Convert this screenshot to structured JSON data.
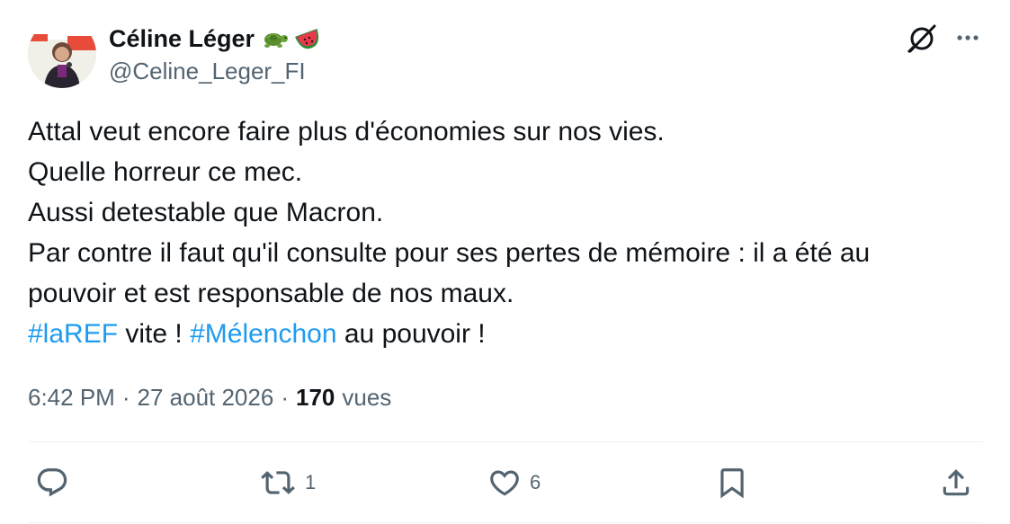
{
  "author": {
    "display_name": "Céline Léger",
    "handle": "@Celine_Leger_FI",
    "emojis": [
      "turtle-emoji",
      "watermelon-emoji"
    ]
  },
  "tweet": {
    "lines": [
      "Attal veut encore faire plus d'économies sur nos vies.",
      "Quelle horreur ce mec.",
      "Aussi detestable que Macron.",
      "Par contre il faut qu'il consulte pour ses pertes de mémoire : il a été au",
      "pouvoir et est responsable de nos maux."
    ],
    "last_line": {
      "hashtag1": "#laREF",
      "text1": " vite ! ",
      "hashtag2": "#Mélenchon",
      "text2": " au pouvoir !"
    }
  },
  "meta": {
    "time": "6:42 PM",
    "date": "27 août 2026",
    "views_count": "170",
    "views_label": "vues"
  },
  "actions": {
    "reply_count": "",
    "retweet_count": "1",
    "like_count": "6"
  },
  "colors": {
    "text": "#0f1419",
    "secondary": "#536471",
    "link": "#1d9bf0",
    "divider": "#eff3f4"
  },
  "icons": [
    "grok-icon",
    "more-icon",
    "reply-icon",
    "retweet-icon",
    "like-icon",
    "bookmark-icon",
    "share-icon"
  ]
}
